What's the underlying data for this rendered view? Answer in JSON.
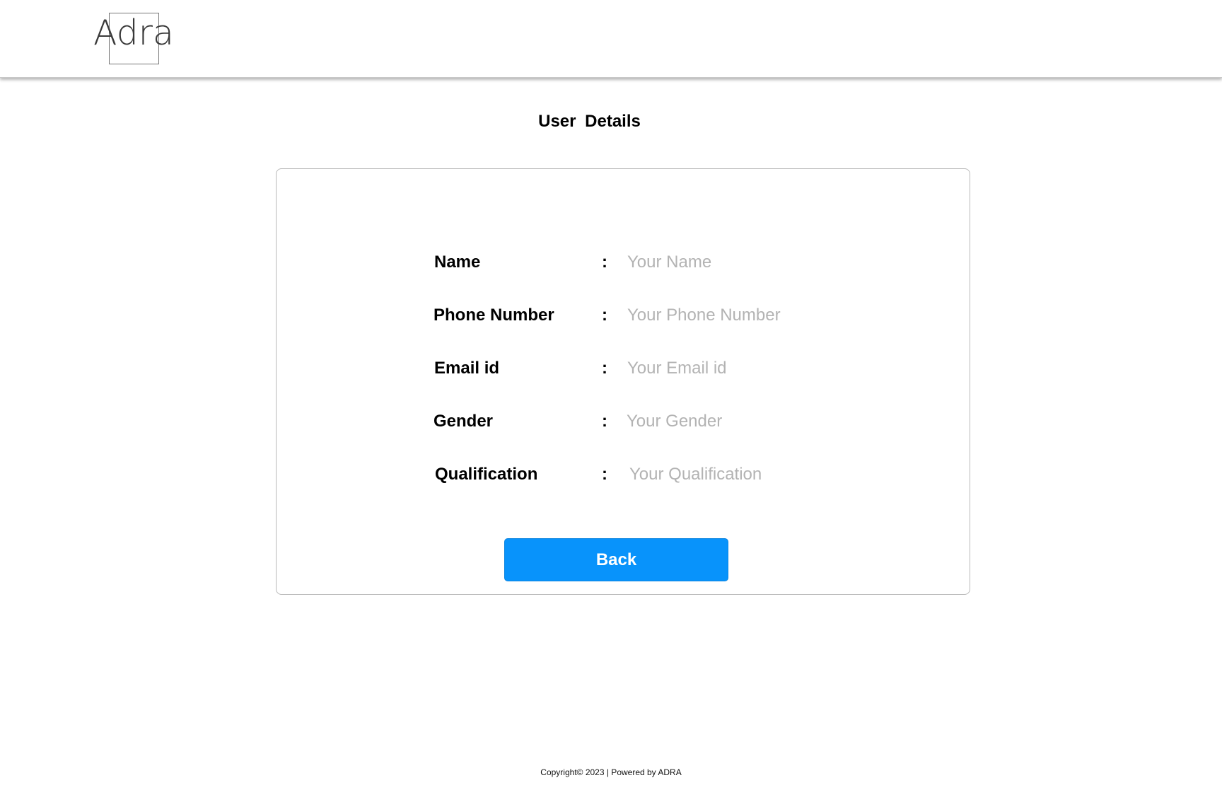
{
  "header": {
    "logo_text": "Adra"
  },
  "page": {
    "title": "User  Details"
  },
  "form": {
    "separator": ":",
    "fields": [
      {
        "label": "Name",
        "placeholder": "Your Name"
      },
      {
        "label": "Phone Number",
        "placeholder": "Your Phone Number"
      },
      {
        "label": "Email id",
        "placeholder": "Your Email id"
      },
      {
        "label": "Gender",
        "placeholder": "Your Gender"
      },
      {
        "label": "Qualification",
        "placeholder": "Your Qualification"
      }
    ],
    "back_label": "Back"
  },
  "footer": {
    "text": "Copyright© 2023 | Powered by ADRA"
  },
  "colors": {
    "primary_button": "#0893fb",
    "placeholder": "#b3b3b3",
    "card_border": "#b9b9b9"
  }
}
